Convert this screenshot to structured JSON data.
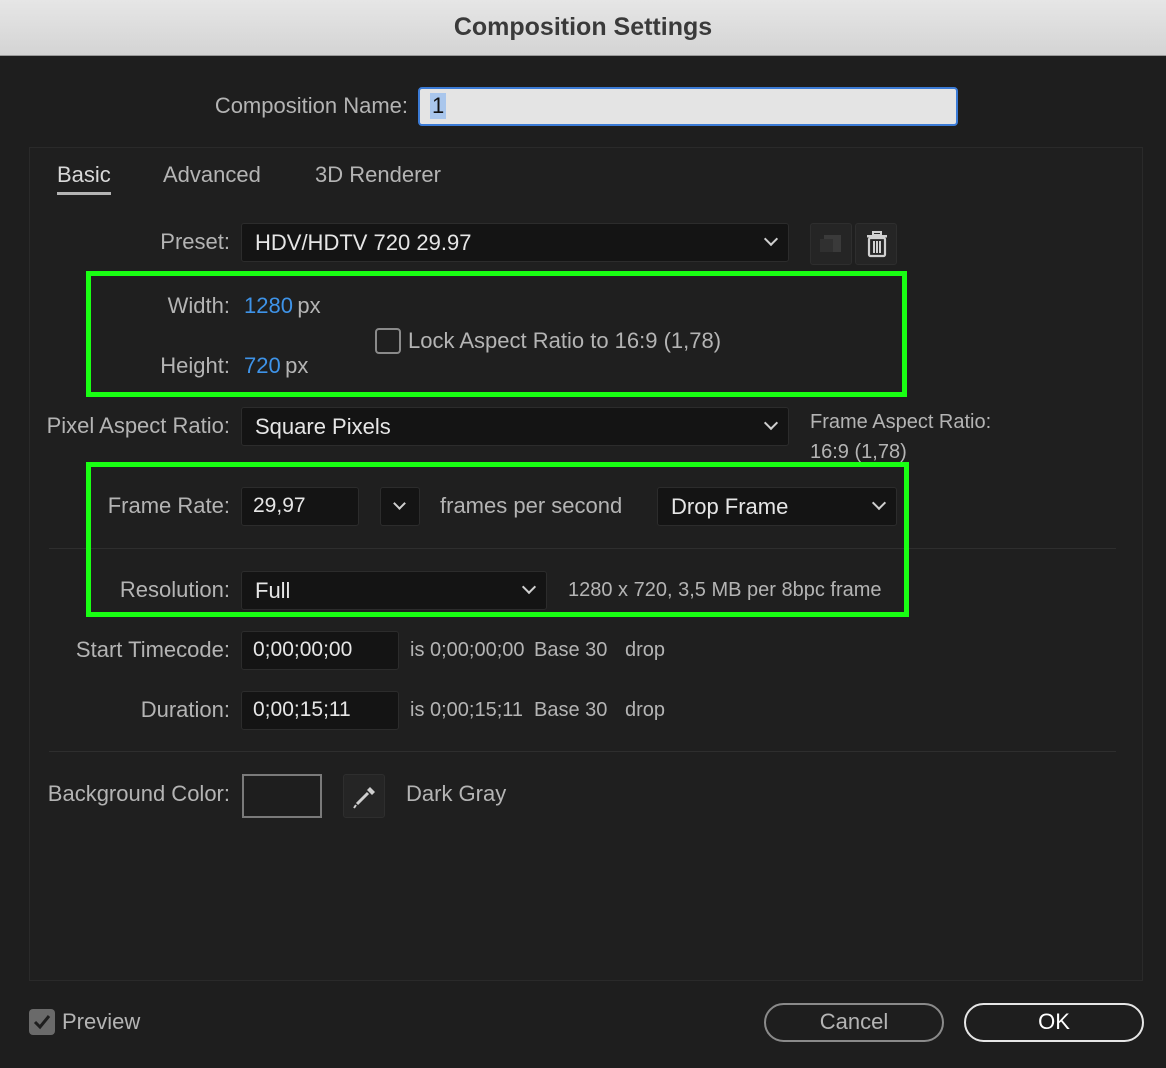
{
  "window": {
    "title": "Composition Settings"
  },
  "comp_name": {
    "label": "Composition Name:",
    "value": "1"
  },
  "tabs": [
    {
      "label": "Basic",
      "active": true
    },
    {
      "label": "Advanced",
      "active": false
    },
    {
      "label": "3D Renderer",
      "active": false
    }
  ],
  "preset": {
    "label": "Preset:",
    "value": "HDV/HDTV 720 29.97"
  },
  "width": {
    "label": "Width:",
    "value": "1280",
    "unit": "px"
  },
  "height": {
    "label": "Height:",
    "value": "720",
    "unit": "px"
  },
  "lock_aspect": {
    "label": "Lock Aspect Ratio to 16:9 (1,78)",
    "checked": false
  },
  "pixel_aspect": {
    "label": "Pixel Aspect Ratio:",
    "value": "Square Pixels"
  },
  "frame_aspect": {
    "label": "Frame Aspect Ratio:",
    "value": "16:9 (1,78)"
  },
  "frame_rate": {
    "label": "Frame Rate:",
    "value": "29,97",
    "unit_label": "frames per second",
    "mode": "Drop Frame"
  },
  "resolution": {
    "label": "Resolution:",
    "value": "Full",
    "info": "1280 x 720, 3,5 MB per 8bpc frame"
  },
  "start_timecode": {
    "label": "Start Timecode:",
    "value": "0;00;00;00",
    "is": "is 0;00;00;00",
    "base": "Base 30",
    "drop": "drop"
  },
  "duration": {
    "label": "Duration:",
    "value": "0;00;15;11",
    "is": "is 0;00;15;11",
    "base": "Base 30",
    "drop": "drop"
  },
  "background": {
    "label": "Background Color:",
    "name": "Dark Gray",
    "swatch": "#1e1e1e"
  },
  "preview": {
    "label": "Preview",
    "checked": true
  },
  "buttons": {
    "cancel": "Cancel",
    "ok": "OK"
  },
  "colors": {
    "accent_blue": "#3e93e8",
    "highlight_green": "#19ff13",
    "background": "#1e1e1e"
  }
}
